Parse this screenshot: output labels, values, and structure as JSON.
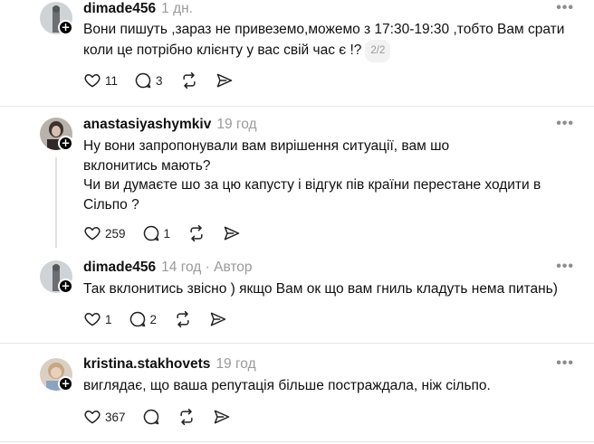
{
  "posts": [
    {
      "username": "dimade456",
      "time": "1 дн.",
      "text_lines": [
        "Вони пишуть ,зараз не привеземо,можемо з 17:30-19:30 ,тобто Вам срати",
        "коли це потрібно клієнту у вас свій час є !?"
      ],
      "page_badge": "2/2",
      "likes": "11",
      "replies": "3"
    },
    {
      "username": "anastasiyashymkiv",
      "time": "19 год",
      "text_lines": [
        "Ну вони запропонували вам вирішення ситуації, вам шо",
        "вклонитись мають?",
        "Чи ви думаєте шо за цю капусту і відгук пів країни перестане ходити в",
        "Сільпо ?"
      ],
      "likes": "259",
      "replies": "1"
    },
    {
      "username": "dimade456",
      "time": "14 год",
      "author_label": "· Автор",
      "text_lines": [
        "Так вклонитись звісно ) якщо Вам ок що вам гниль кладуть нема питань)"
      ],
      "likes": "1",
      "replies": "2"
    },
    {
      "username": "kristina.stakhovets",
      "time": "19 год",
      "text_lines": [
        "виглядає, що ваша репутація більше постраждала, ніж сільпо."
      ],
      "likes": "367",
      "replies": ""
    }
  ],
  "icons": {
    "more": "more-icon",
    "like": "heart-icon",
    "reply": "comment-icon",
    "repost": "repost-icon",
    "share": "share-icon",
    "follow": "plus-icon"
  }
}
